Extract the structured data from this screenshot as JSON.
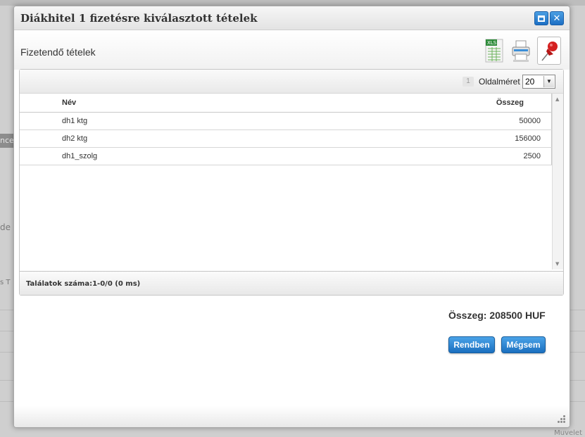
{
  "background": {
    "left_tab_text": "nce",
    "left_text_1": "de",
    "left_text_2": "s T",
    "muvelet": "Muvelet"
  },
  "dialog": {
    "title": "Diákhitel 1 fizetésre kiválasztott tételek",
    "section_title": "Fizetendő tételek",
    "toolbar": {
      "xls_icon": "excel-export-icon",
      "print_icon": "printer-icon",
      "pin_icon": "pushpin-icon",
      "xls_text": "XLS"
    },
    "grid": {
      "page_number": "1",
      "page_size_label": "Oldalméret",
      "page_size_value": "20",
      "columns": {
        "name": "Név",
        "amount": "Összeg"
      },
      "rows": [
        {
          "name": "dh1 ktg",
          "amount": "50000"
        },
        {
          "name": "dh2 ktg",
          "amount": "156000"
        },
        {
          "name": "dh1_szolg",
          "amount": "2500"
        }
      ],
      "result_count": "Találatok száma:1-0/0 (0 ms)"
    },
    "total_text": "Összeg: 208500 HUF",
    "buttons": {
      "ok": "Rendben",
      "cancel": "Mégsem"
    }
  },
  "colors": {
    "accent_button": "#1b6fbf",
    "pin_red": "#d42020"
  }
}
